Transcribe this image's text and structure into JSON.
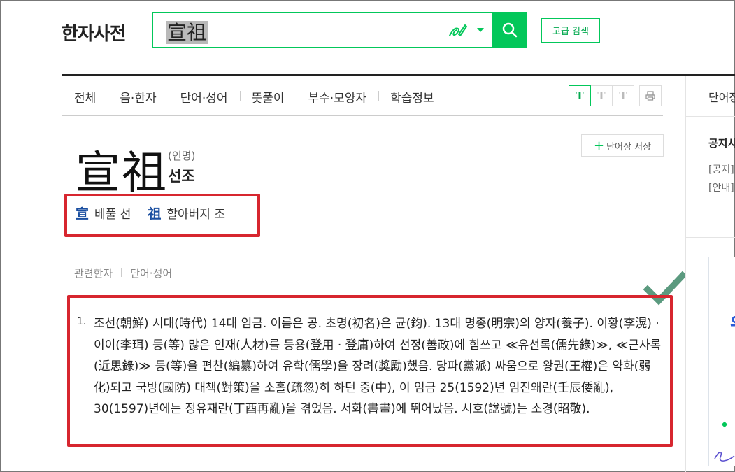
{
  "header": {
    "logo": "한자사전",
    "search": {
      "query": "宣祖"
    },
    "advanced_search_label": "고급 검색"
  },
  "tabs": [
    "전체",
    "음·한자",
    "단어·성어",
    "뜻풀이",
    "부수·모양자",
    "학습정보"
  ],
  "text_size_buttons": [
    "T",
    "T",
    "T"
  ],
  "entry": {
    "headword": "宣祖",
    "pos": "(인명)",
    "reading": "선조",
    "save_label": "단어장 저장",
    "characters": [
      {
        "hanja": "宣",
        "meaning": "베풀 선"
      },
      {
        "hanja": "祖",
        "meaning": "할아버지 조"
      }
    ],
    "related": [
      "관련한자",
      "단어·성어"
    ],
    "definition_number": "1.",
    "definition": "조선(朝鮮) 시대(時代) 14대 임금. 이름은 공. 초명(初名)은 균(鈞). 13대 명종(明宗)의 양자(養子). 이황(李滉) · 이이(李珥) 등(等) 많은 인재(人材)를 등용(登用 · 登庸)하여 선정(善政)에 힘쓰고 ≪유선록(儒先錄)≫, ≪근사록(近思錄)≫ 등(等)을 편찬(編纂)하여 유학(儒學)을 장려(獎勵)했음. 당파(黨派) 싸움으로 왕권(王權)은 약화(弱化)되고 국방(國防) 대책(對策)을 소홀(疏忽)히 하던 중(中), 이 임금 25(1592)년 임진왜란(壬辰倭亂), 30(1597)년에는 정유재란(丁酉再亂)을 겪었음. 서화(書畫)에 뛰어났음. 시호(諡號)는 소경(昭敬)."
  },
  "sidebar": {
    "label": "단어장",
    "notice_title": "공지사항",
    "links": [
      "[공지]",
      "[안내]"
    ]
  },
  "colors": {
    "accent": "#03c75a",
    "highlight_border": "#d7262f",
    "hanja_link": "#1a4ea0",
    "checkmark": "#5b9a7f"
  }
}
